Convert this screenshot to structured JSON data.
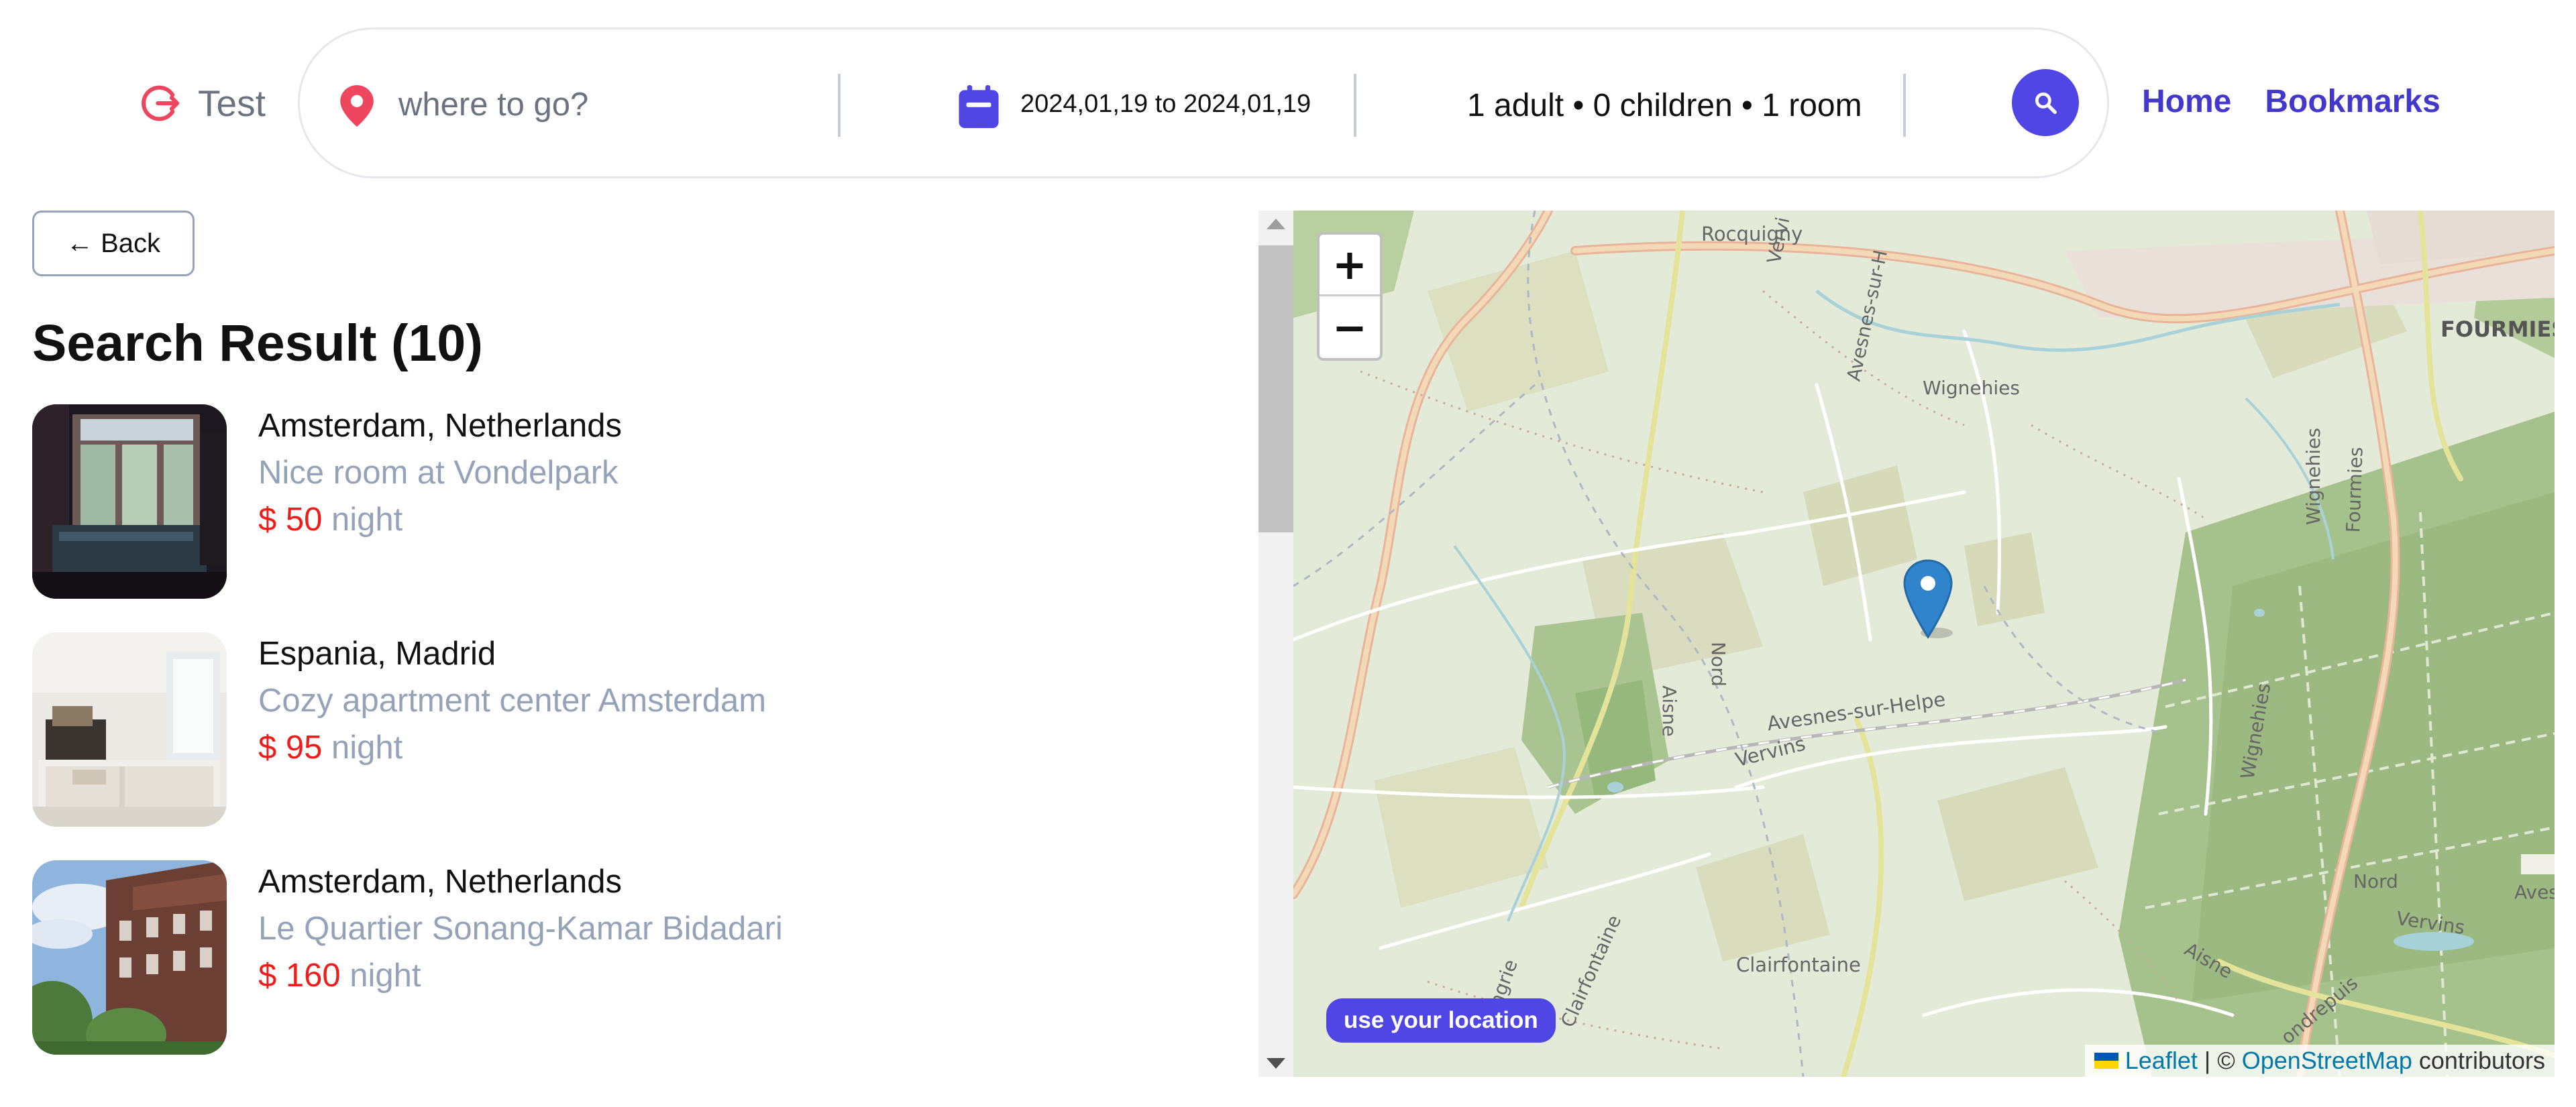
{
  "header": {
    "logo_text": "Test",
    "search": {
      "location_placeholder": "where to go?",
      "dates": "2024,01,19 to 2024,01,19",
      "guests": "1 adult • 0 children • 1 room"
    },
    "nav": {
      "home": "Home",
      "bookmarks": "Bookmarks"
    }
  },
  "back_label": "← Back",
  "results_title": "Search Result (10)",
  "results": [
    {
      "location": "Amsterdam, Netherlands",
      "title": "Nice room at Vondelpark",
      "price": "$ 50",
      "unit": "night"
    },
    {
      "location": "Espania, Madrid",
      "title": "Cozy apartment center Amsterdam",
      "price": "$ 95",
      "unit": "night"
    },
    {
      "location": "Amsterdam, Netherlands",
      "title": "Le Quartier Sonang-Kamar Bidadari",
      "price": "$ 160",
      "unit": "night"
    }
  ],
  "map": {
    "zoom_in": "+",
    "zoom_out": "−",
    "use_location": "use your location",
    "attribution": {
      "leaflet": "Leaflet",
      "separator": " | © ",
      "osm": "OpenStreetMap",
      "suffix": " contributors"
    },
    "labels": {
      "rocquigny": "Rocquigny",
      "fourmies": "FOURMIES",
      "wignehies": "Wignehies",
      "avesnes_sur_helpe": "Avesnes-sur-Helpe",
      "vervins": "Vervins",
      "clairfontaine": "Clairfontaine",
      "nord": "Nord",
      "aisne": "Aisne",
      "vervins_2": "Vervins",
      "nord_2": "Nord",
      "aisne_2": "Aisne",
      "wignehies_v": "Wignehies",
      "fourmies_v": "Fourmies",
      "wignehies_v2": "Wignehies",
      "avesnes_sur_h": "Avesnes-sur-H",
      "vervi": "Vervi",
      "clairfontaine_v": "Clairfontaine",
      "haengrie": "haengrie",
      "ondrepuis": "ondrepuis",
      "aves": "Aves"
    }
  },
  "colors": {
    "accent": "#4f46e5",
    "nav": "#4338ca",
    "price": "#ef1c1c",
    "muted": "#94a3b8",
    "location_pin": "#ef4660"
  }
}
